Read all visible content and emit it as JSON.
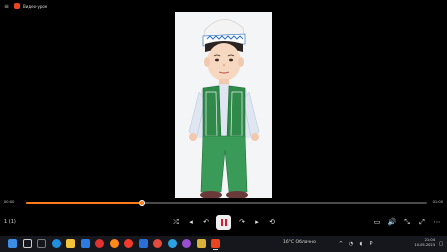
{
  "window": {
    "title": "Видео-урок",
    "menu_icon": "menu-icon",
    "accent": "#ff7a1a"
  },
  "playback": {
    "current_time": "00:00",
    "duration": "01:00",
    "progress": 0.29,
    "state": "playing",
    "speed_label": "1 (1)"
  },
  "controls": [
    {
      "name": "shuffle-icon",
      "glyph": "⤮"
    },
    {
      "name": "previous-icon",
      "glyph": "◂"
    },
    {
      "name": "rewind-icon",
      "glyph": "↶"
    },
    {
      "name": "forward-icon",
      "glyph": "↷"
    },
    {
      "name": "next-icon",
      "glyph": "▸"
    },
    {
      "name": "repeat-icon",
      "glyph": "⟲"
    },
    {
      "name": "subtitles-icon",
      "glyph": "▭"
    },
    {
      "name": "volume-icon",
      "glyph": "🔊"
    },
    {
      "name": "minimize-player-icon",
      "glyph": "⤡"
    },
    {
      "name": "fullscreen-icon",
      "glyph": "⤢"
    },
    {
      "name": "more-icon",
      "glyph": "⋯"
    }
  ],
  "taskbar": {
    "weather": "16°C Облачно",
    "time": "21:04",
    "date": "10.05.2023",
    "icons": [
      {
        "name": "windows-start-icon",
        "color": "#3a8ee6"
      },
      {
        "name": "search-icon",
        "color": "#cfcfcf"
      },
      {
        "name": "task-view-icon",
        "color": "#7a7a7a"
      },
      {
        "name": "edge-icon",
        "color": "#1f8fe0"
      },
      {
        "name": "file-explorer-icon",
        "color": "#f2c23a"
      },
      {
        "name": "store-icon",
        "color": "#2b7be0"
      },
      {
        "name": "opera-icon",
        "color": "#e0322e"
      },
      {
        "name": "firefox-icon",
        "color": "#ff8a1a"
      },
      {
        "name": "yandex-icon",
        "color": "#f23a2a"
      },
      {
        "name": "mail-icon",
        "color": "#2a6fd6"
      },
      {
        "name": "chrome-icon",
        "color": "#e54b3c"
      },
      {
        "name": "telegram-icon",
        "color": "#2aa2e0"
      },
      {
        "name": "photos-icon",
        "color": "#9a4fd0"
      },
      {
        "name": "folder-icon",
        "color": "#d8b23a"
      },
      {
        "name": "media-player-icon",
        "color": "#e8441f"
      }
    ]
  }
}
